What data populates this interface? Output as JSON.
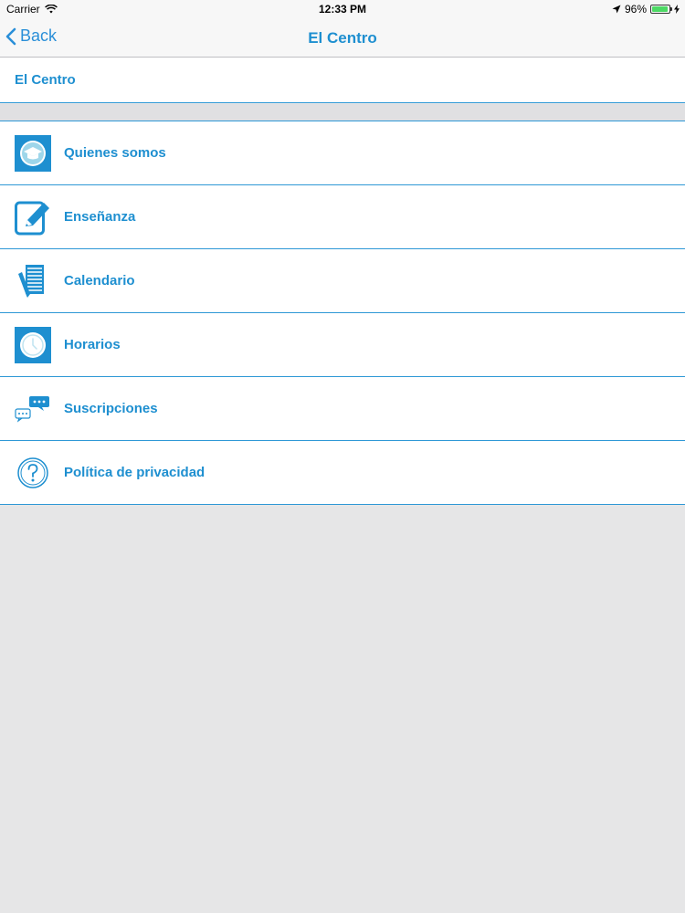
{
  "status": {
    "carrier": "Carrier",
    "time": "12:33 PM",
    "battery": "96%",
    "battery_level": 0.96
  },
  "nav": {
    "back_label": "Back",
    "title": "El Centro"
  },
  "section": {
    "header": "El Centro"
  },
  "menu": {
    "items": [
      {
        "label": "Quienes somos",
        "icon": "graduation-cap-icon"
      },
      {
        "label": "Enseñanza",
        "icon": "edit-pencil-icon"
      },
      {
        "label": "Calendario",
        "icon": "calendar-notebook-icon"
      },
      {
        "label": "Horarios",
        "icon": "clock-icon"
      },
      {
        "label": "Suscripciones",
        "icon": "chat-bubbles-icon"
      },
      {
        "label": "Política de privacidad",
        "icon": "help-question-icon"
      }
    ]
  },
  "colors": {
    "accent": "#1e8fd0",
    "divider": "#2e98d6",
    "background": "#e6e6e7"
  }
}
